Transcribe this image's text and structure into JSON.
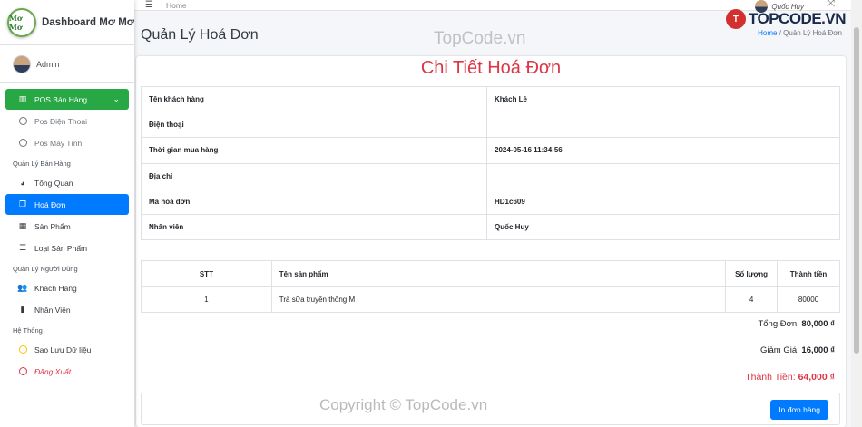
{
  "brand": {
    "logo_text": "Mơ Mơ",
    "name": "Dashboard Mơ Mơ"
  },
  "user": {
    "name": "Admin"
  },
  "sidebar": {
    "pos_label": "POS Bán Hàng",
    "pos_items": [
      "Pos Điện Thoại",
      "Pos Máy Tính"
    ],
    "section_sales": "Quản Lý Bán Hàng",
    "sales_items": [
      {
        "label": "Tổng Quan",
        "icon": "gauge-icon"
      },
      {
        "label": "Hoá Đơn",
        "icon": "invoice-icon"
      },
      {
        "label": "Sản Phẩm",
        "icon": "grid-icon"
      },
      {
        "label": "Loại Sản Phẩm",
        "icon": "list-icon"
      }
    ],
    "section_users": "Quản Lý Người Dùng",
    "user_items": [
      {
        "label": "Khách Hàng",
        "icon": "users-icon"
      },
      {
        "label": "Nhân Viên",
        "icon": "book-icon"
      }
    ],
    "section_system": "Hệ Thống",
    "system_items": [
      "Sao Lưu Dữ liệu",
      "Đăng Xuất"
    ]
  },
  "topbar": {
    "home": "Home",
    "user": "Quốc Huy"
  },
  "watermark": {
    "badge": "T",
    "logo": "TOPCODE.VN",
    "center": "TopCode.vn",
    "copyright": "Copyright © TopCode.vn"
  },
  "page": {
    "title": "Quản Lý Hoá Đơn",
    "breadcrumb_home": "Home",
    "breadcrumb_sep": "/",
    "breadcrumb_current": "Quản Lý Hoá Đơn"
  },
  "invoice": {
    "title": "Chi Tiết Hoá Đơn",
    "fields": [
      {
        "label": "Tên khách hàng",
        "value": "Khách Lẻ"
      },
      {
        "label": "Điện thoại",
        "value": ""
      },
      {
        "label": "Thời gian mua hàng",
        "value": "2024-05-16 11:34:56"
      },
      {
        "label": "Địa chỉ",
        "value": ""
      },
      {
        "label": "Mã hoá đơn",
        "value": "HD1c609"
      },
      {
        "label": "Nhân viên",
        "value": "Quốc Huy"
      }
    ],
    "columns": {
      "stt": "STT",
      "name": "Tên sản phẩm",
      "qty": "Số lượng",
      "total": "Thành tiền"
    },
    "items": [
      {
        "stt": "1",
        "name": "Trà sữa truyền thống M",
        "qty": "4",
        "total": "80000"
      }
    ],
    "sum_label": "Tổng Đơn:",
    "sum_value": "80,000 ₫",
    "discount_label": "Giảm Giá:",
    "discount_value": "16,000 ₫",
    "final_label": "Thành Tiền:",
    "final_value": "64,000 ₫",
    "print_label": "In đơn hàng"
  },
  "colors": {
    "accent": "#007bff",
    "pos": "#28a745",
    "danger": "#dc3545"
  }
}
